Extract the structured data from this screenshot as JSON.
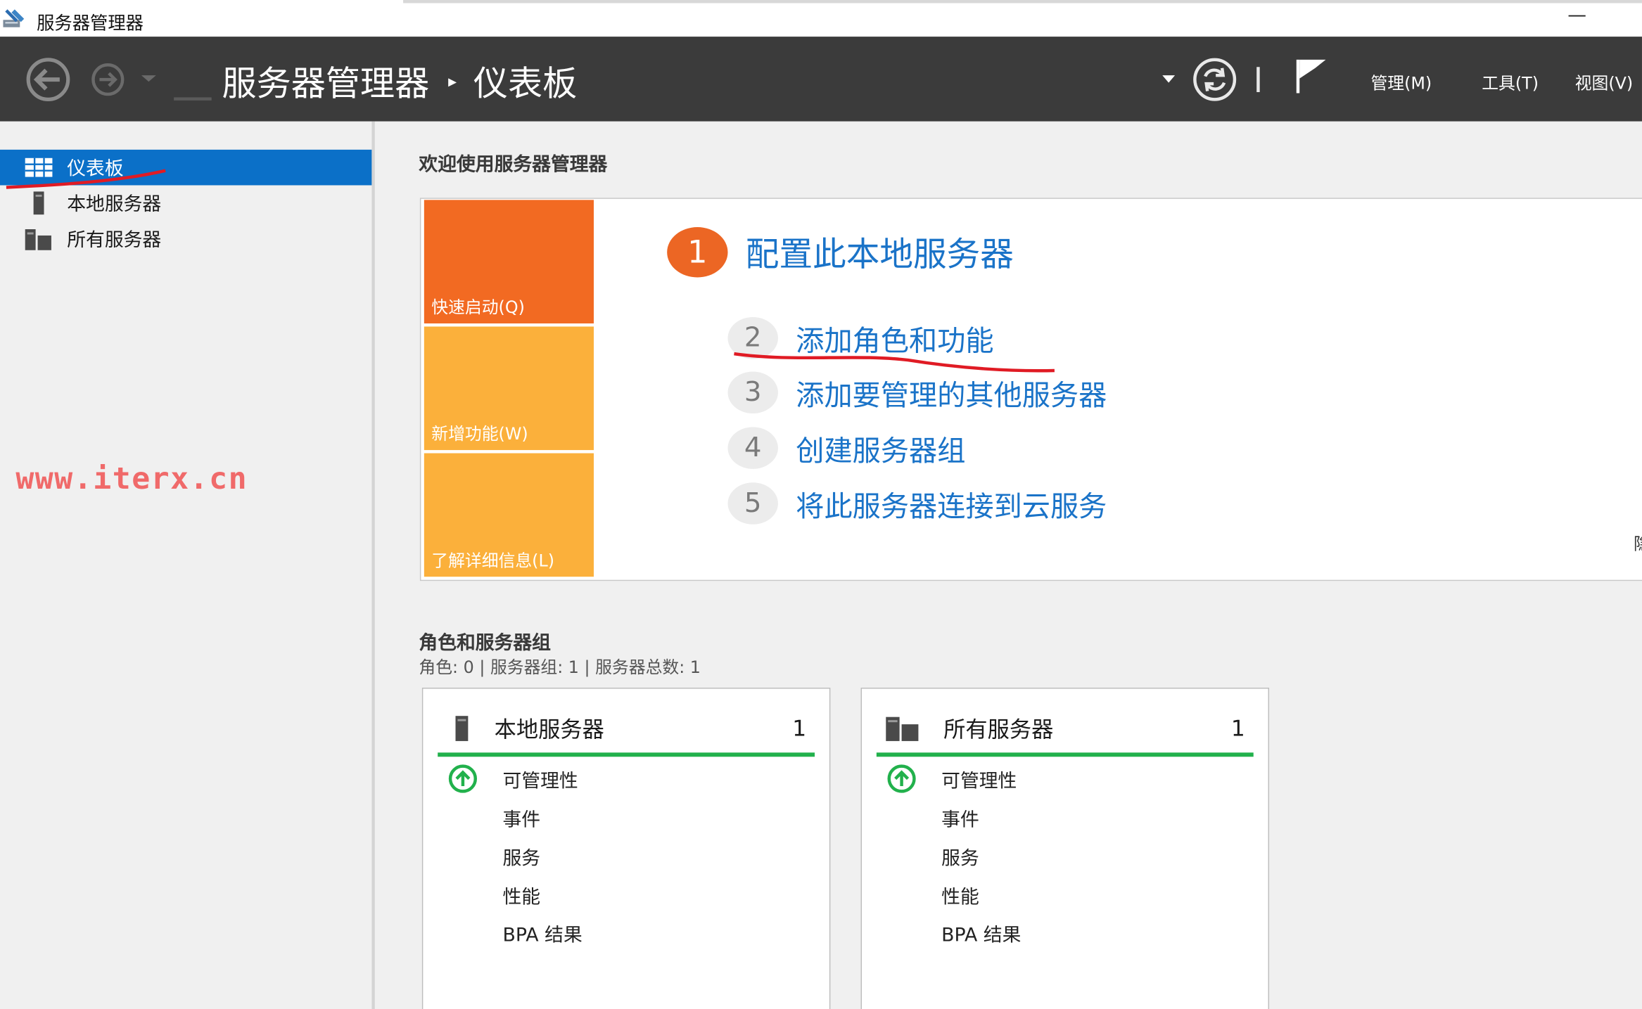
{
  "window": {
    "title": "服务器管理器",
    "minimize_glyph": "—"
  },
  "header": {
    "breadcrumb_app": "服务器管理器",
    "breadcrumb_sep": "▸",
    "breadcrumb_page": "仪表板",
    "menu": [
      "管理(M)",
      "工具(T)",
      "视图(V)"
    ]
  },
  "sidebar": {
    "items": [
      {
        "label": "仪表板",
        "icon": "dashboard-icon",
        "active": true
      },
      {
        "label": "本地服务器",
        "icon": "server-icon",
        "active": false
      },
      {
        "label": "所有服务器",
        "icon": "servers-icon",
        "active": false
      }
    ]
  },
  "watermark": "www.iterx.cn",
  "welcome": {
    "heading": "欢迎使用服务器管理器",
    "tiles": [
      {
        "label": "快速启动(Q)",
        "color": "#f26a22"
      },
      {
        "label": "新增功能(W)",
        "color": "#fbb03b"
      },
      {
        "label": "了解详细信息(L)",
        "color": "#fbb03b"
      }
    ],
    "step1": {
      "num": "1",
      "label": "配置此本地服务器"
    },
    "steps": [
      {
        "num": "2",
        "label": "添加角色和功能"
      },
      {
        "num": "3",
        "label": "添加要管理的其他服务器"
      },
      {
        "num": "4",
        "label": "创建服务器组"
      },
      {
        "num": "5",
        "label": "将此服务器连接到云服务"
      }
    ],
    "right_edge_char": "隐"
  },
  "roles": {
    "heading": "角色和服务器组",
    "stats": "角色: 0 | 服务器组: 1 | 服务器总数: 1",
    "cards": [
      {
        "title": "本地服务器",
        "count": "1",
        "icon": "server-icon",
        "rows": [
          "可管理性",
          "事件",
          "服务",
          "性能",
          "BPA 结果"
        ]
      },
      {
        "title": "所有服务器",
        "count": "1",
        "icon": "servers-icon",
        "rows": [
          "可管理性",
          "事件",
          "服务",
          "性能",
          "BPA 结果"
        ]
      }
    ]
  },
  "colors": {
    "header_bg": "#3b3b3b",
    "active_nav": "#0b70c8",
    "link": "#1a73c8",
    "accent_orange": "#ec6624",
    "status_green": "#22b14c",
    "annotation_red": "#e01b24"
  }
}
